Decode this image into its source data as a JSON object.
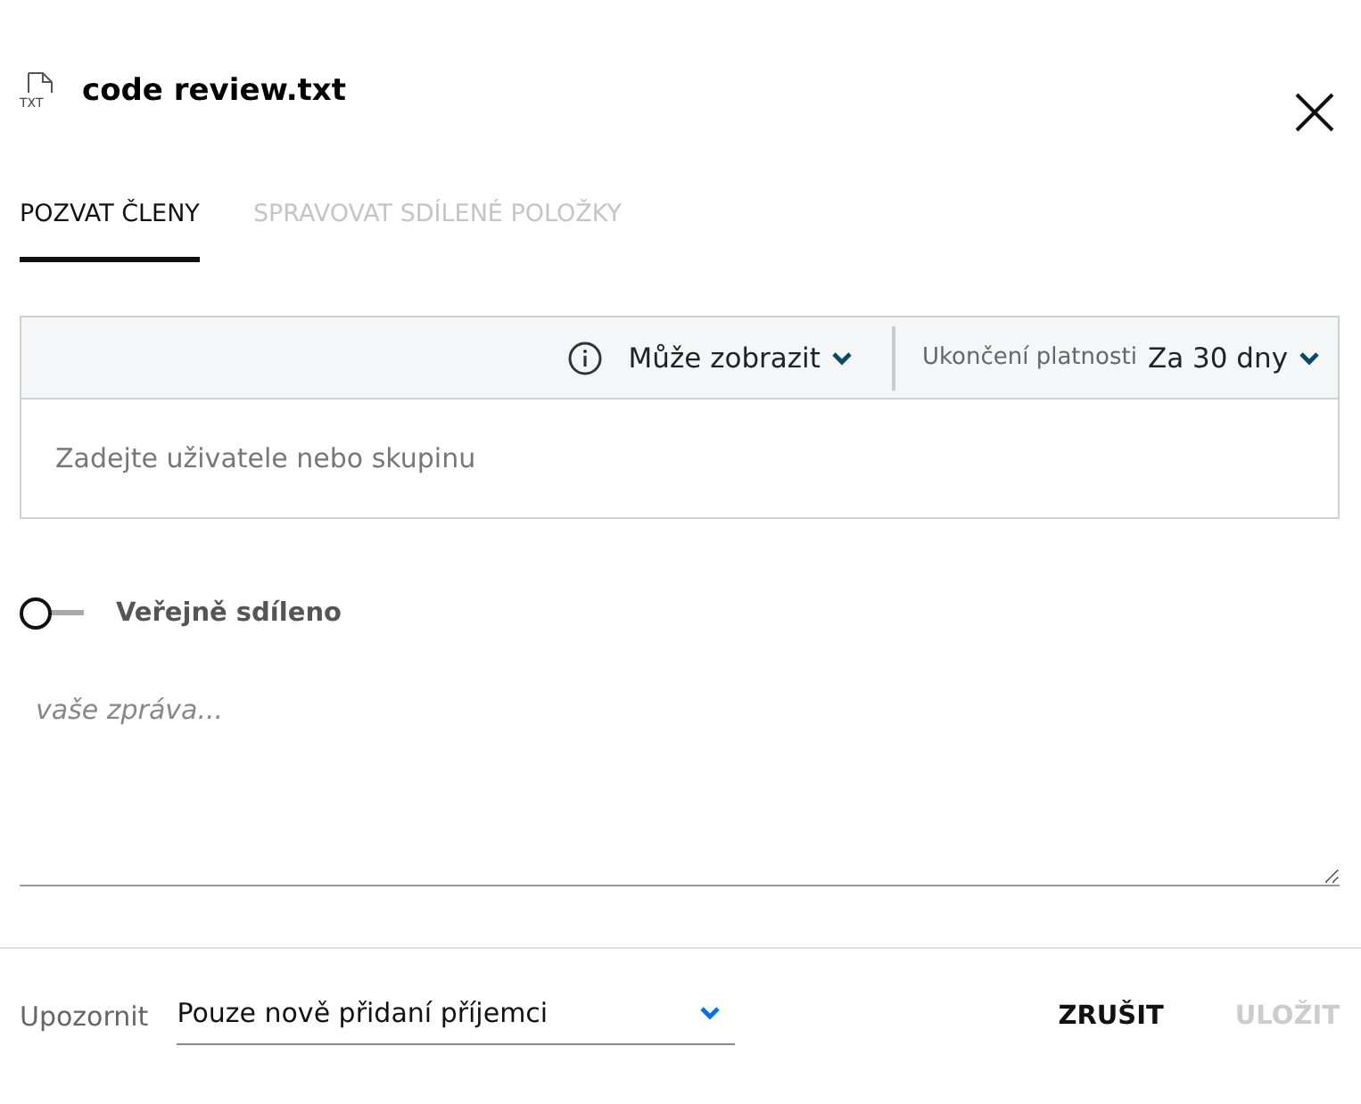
{
  "window": {
    "title": "code review.txt",
    "file_icon": "TXT"
  },
  "tabs": [
    {
      "label": "POZVAT ČLENY",
      "selected": true
    },
    {
      "label": "SPRAVOVAT SDÍLENÉ POLOŽKY",
      "selected": false
    }
  ],
  "invite": {
    "role": "Může zobrazit",
    "expiry_label": "Ukončení platnosti",
    "expiry_value": "Za 30 dny",
    "placeholder": "Zadejte uživatele nebo skupinu"
  },
  "public_share": {
    "label": "Veřejně sdíleno",
    "on": false
  },
  "message": {
    "placeholder": "vaše zpráva..."
  },
  "notify": {
    "label": "Upozornit",
    "value": "Pouze nově přidaní příjemci"
  },
  "buttons": [
    {
      "label": "ZRUŠIT",
      "disabled": false
    },
    {
      "label": "ULOŽIT",
      "disabled": true
    }
  ]
}
